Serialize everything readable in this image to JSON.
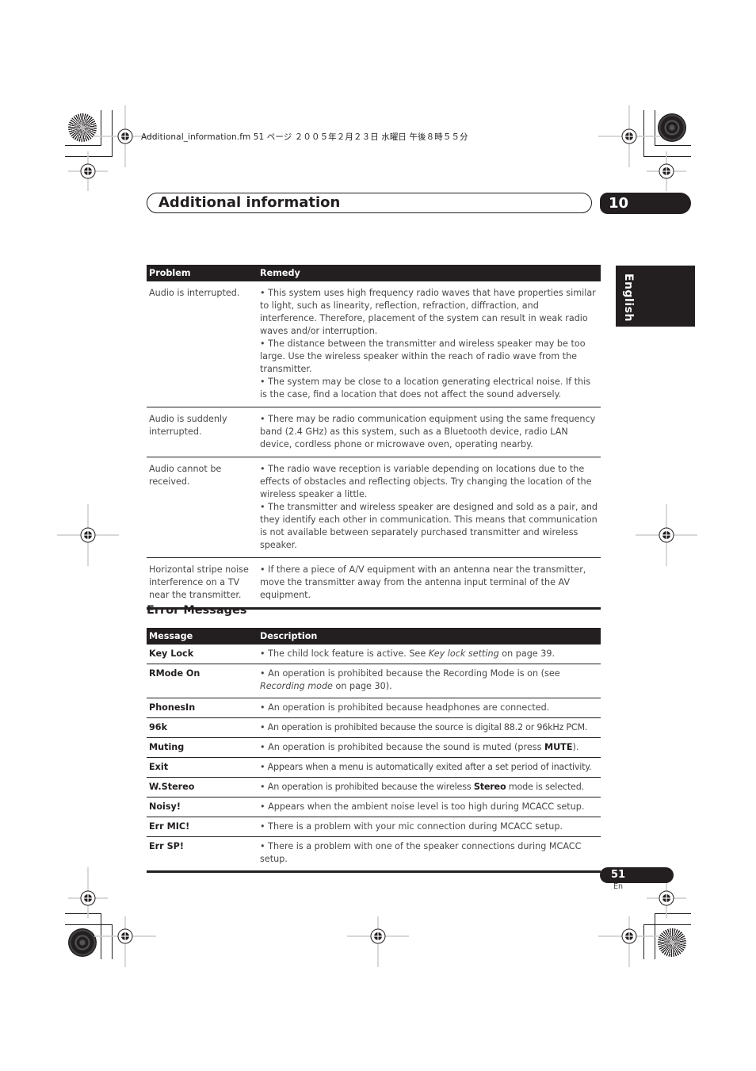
{
  "file_header": "Additional_information.fm  51 ページ  ２００５年２月２３日  水曜日  午後８時５５分",
  "chapter": {
    "title": "Additional information",
    "number": "10"
  },
  "language_tab": "English",
  "troubleshooting": {
    "headers": [
      "Problem",
      "Remedy"
    ],
    "rows": [
      {
        "problem": "Audio is interrupted.",
        "remedies": [
          "This system uses high frequency radio waves that have properties similar to light, such as linearity, reflection, refraction, diffraction, and interference. Therefore, placement of the system can result in weak radio waves and/or interruption.",
          "The distance between the transmitter and wireless speaker may be too large. Use the wireless speaker within the reach of radio wave from the transmitter.",
          "The system may be close to a location generating electrical noise. If this is the case, find a location that does not affect the sound adversely."
        ]
      },
      {
        "problem": "Audio is suddenly interrupted.",
        "remedies": [
          "There may be radio communication equipment using the same frequency band (2.4 GHz) as this system, such as a Bluetooth device, radio LAN device, cordless phone or microwave oven, operating nearby."
        ]
      },
      {
        "problem": "Audio cannot be received.",
        "remedies": [
          "The radio wave reception is variable depending on locations due to the effects of obstacles and reflecting objects. Try changing the location of the wireless speaker a little.",
          "The transmitter and wireless speaker are designed and sold as a pair, and they identify each other in communication. This means that communication is not available between separately purchased transmitter and wireless speaker."
        ]
      },
      {
        "problem": "Horizontal stripe noise interference on a TV near the transmitter.",
        "remedies": [
          "If there a piece of A/V equipment with an antenna near the transmitter, move the transmitter away from the antenna input terminal of the AV equipment."
        ]
      }
    ]
  },
  "error_messages": {
    "heading": "Error Messages",
    "headers": [
      "Message",
      "Description"
    ],
    "rows": [
      {
        "message": "Key Lock",
        "parts": [
          "The child lock feature is active. See ",
          "Key lock setting",
          " on page 39."
        ]
      },
      {
        "message": "RMode On",
        "parts": [
          "An operation is prohibited because the Recording Mode is on (see ",
          "Recording mode",
          " on page 30)."
        ]
      },
      {
        "message": "PhonesIn",
        "parts": [
          "An operation is prohibited because headphones are connected."
        ]
      },
      {
        "message": "96k",
        "parts": [
          "An operation is prohibited because the source is digital 88.2 or 96kHz PCM."
        ]
      },
      {
        "message": "Muting",
        "parts": [
          "An operation is prohibited because the sound is muted (press ",
          "MUTE",
          ")."
        ]
      },
      {
        "message": "Exit",
        "parts": [
          "Appears when a menu is automatically exited after a set period of inactivity."
        ]
      },
      {
        "message": "W.Stereo",
        "parts": [
          "An operation is prohibited because the wireless ",
          "Stereo",
          " mode is selected."
        ]
      },
      {
        "message": "Noisy!",
        "parts": [
          "Appears when the ambient noise level is too high during MCACC setup."
        ]
      },
      {
        "message": "Err MIC!",
        "parts": [
          "There is a problem with your mic connection during MCACC setup."
        ]
      },
      {
        "message": "Err SP!",
        "parts": [
          "There is a problem with one of the speaker connections during MCACC setup."
        ]
      }
    ]
  },
  "footer": {
    "page_number": "51",
    "language_code": "En"
  }
}
